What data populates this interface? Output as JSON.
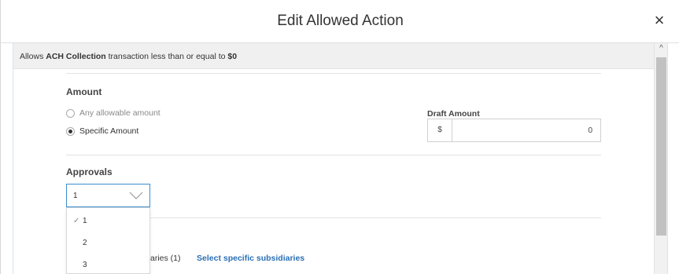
{
  "dialog": {
    "title": "Edit Allowed Action",
    "close_icon": "×"
  },
  "banner": {
    "prefix": "Allows ",
    "transaction": "ACH Collection",
    "middle": " transaction less than or equal to ",
    "limit": "$0"
  },
  "amount": {
    "heading": "Amount",
    "options": [
      {
        "label": "Any allowable amount",
        "checked": false
      },
      {
        "label": "Specific Amount",
        "checked": true
      }
    ],
    "draft_label": "Draft Amount",
    "currency": "$",
    "value": "0"
  },
  "approvals": {
    "heading": "Approvals",
    "selected": "1",
    "options": [
      "1",
      "2",
      "3"
    ],
    "check_glyph": "✓"
  },
  "subsidiaries": {
    "label_fragment": "aries (1)",
    "link_label": "Select specific subsidiaries"
  },
  "scrollbar": {
    "up_arrow": "^"
  },
  "colors": {
    "accent": "#3b8fd0",
    "link": "#2a6fb4",
    "banner_bg": "#f0f0f0"
  }
}
